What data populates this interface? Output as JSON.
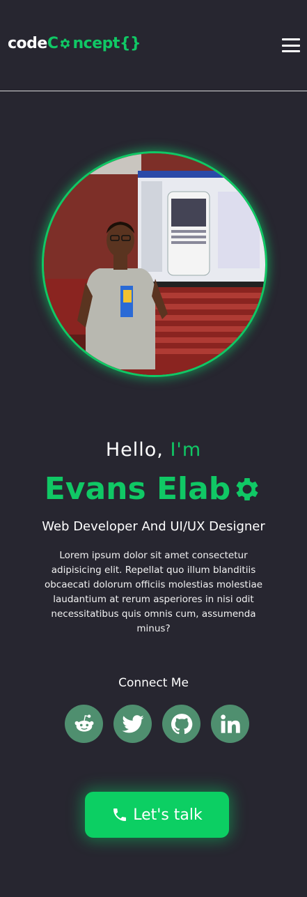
{
  "header": {
    "logo_part1": "code",
    "logo_part2_c": "C",
    "logo_part2_rest": "ncept",
    "logo_braces": "{}"
  },
  "hero": {
    "hello": "Hello,",
    "im": "I'm",
    "name": "Evans Elab",
    "role": "Web Developer And UI/UX Designer",
    "bio": "Lorem ipsum dolor sit amet consectetur adipisicing elit. Repellat quo illum blanditiis obcaecati dolorum officiis molestias molestiae laudantium at rerum asperiores in nisi odit necessitatibus quis omnis cum, assumenda minus?"
  },
  "connect": {
    "title": "Connect Me",
    "links": [
      {
        "icon": "reddit-icon"
      },
      {
        "icon": "twitter-icon"
      },
      {
        "icon": "github-icon"
      },
      {
        "icon": "linkedin-icon"
      }
    ]
  },
  "cta": {
    "label": "Let's talk",
    "icon": "phone-icon"
  },
  "colors": {
    "background": "#272630",
    "accent": "#10c865",
    "social_bg": "#4f8f6f",
    "cta_bg": "#0ccf63"
  }
}
